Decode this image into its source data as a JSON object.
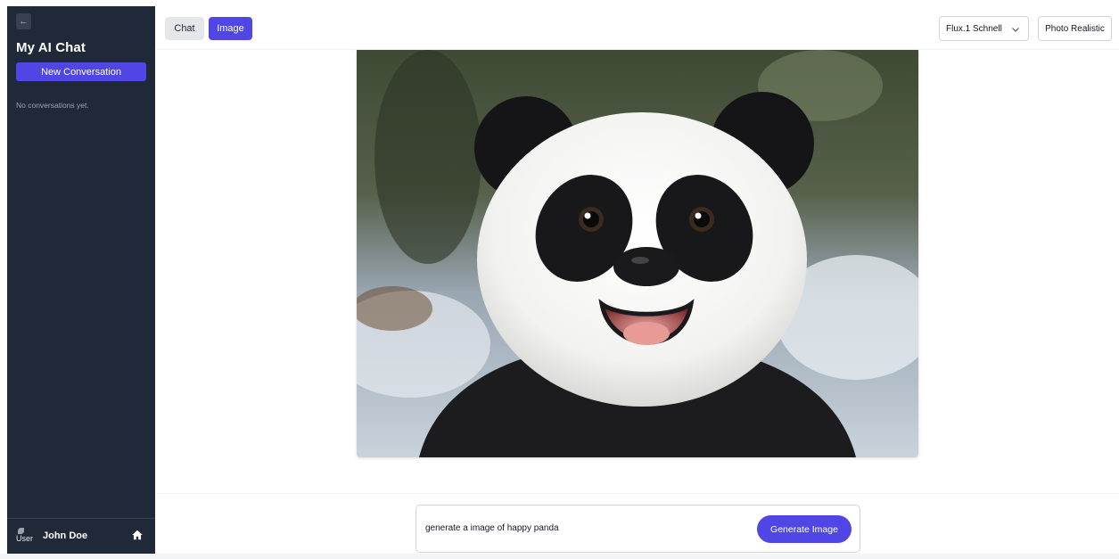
{
  "sidebar": {
    "collapse_glyph": "←",
    "brand_title": "My AI Chat",
    "new_conversation_label": "New Conversation",
    "empty_text": "No conversations yet.",
    "user": {
      "avatar_alt": "User",
      "name": "John Doe"
    },
    "icons": {
      "collapse": "arrow-left-icon",
      "home": "home-icon"
    }
  },
  "topbar": {
    "tabs": [
      {
        "label": "Chat",
        "active": false
      },
      {
        "label": "Image",
        "active": true
      }
    ],
    "model_select": {
      "value": "Flux.1 Schnell"
    },
    "style_button": {
      "label": "Photo Realistic"
    }
  },
  "main": {
    "generated_image": {
      "subject": "happy panda"
    }
  },
  "composer": {
    "prompt_value": "generate a image of happy panda",
    "generate_label": "Generate Image"
  },
  "colors": {
    "sidebar_bg": "#1f2937",
    "accent": "#4f46e5",
    "tab_inactive": "#e5e7eb"
  }
}
